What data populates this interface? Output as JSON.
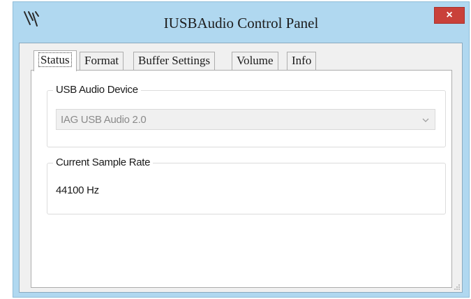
{
  "window": {
    "title": "IUSBAudio Control Panel",
    "close_label": "×"
  },
  "tabs": [
    {
      "label": "Status",
      "selected": true
    },
    {
      "label": "Format",
      "selected": false
    },
    {
      "label": "Buffer Settings",
      "selected": false
    },
    {
      "label": "Volume",
      "selected": false
    },
    {
      "label": "Info",
      "selected": false
    }
  ],
  "status": {
    "device_group_label": "USB Audio Device",
    "device_selected": "IAG USB Audio 2.0",
    "rate_group_label": "Current Sample Rate",
    "rate_value": "44100 Hz"
  },
  "colors": {
    "title_bar": "#b0d8f0",
    "close_button": "#c9413a",
    "panel": "#ffffff"
  },
  "icons": {
    "app": "usb-audio-app-icon",
    "close": "close-icon",
    "dropdown": "chevron-down-icon",
    "grip": "resize-grip-icon"
  }
}
